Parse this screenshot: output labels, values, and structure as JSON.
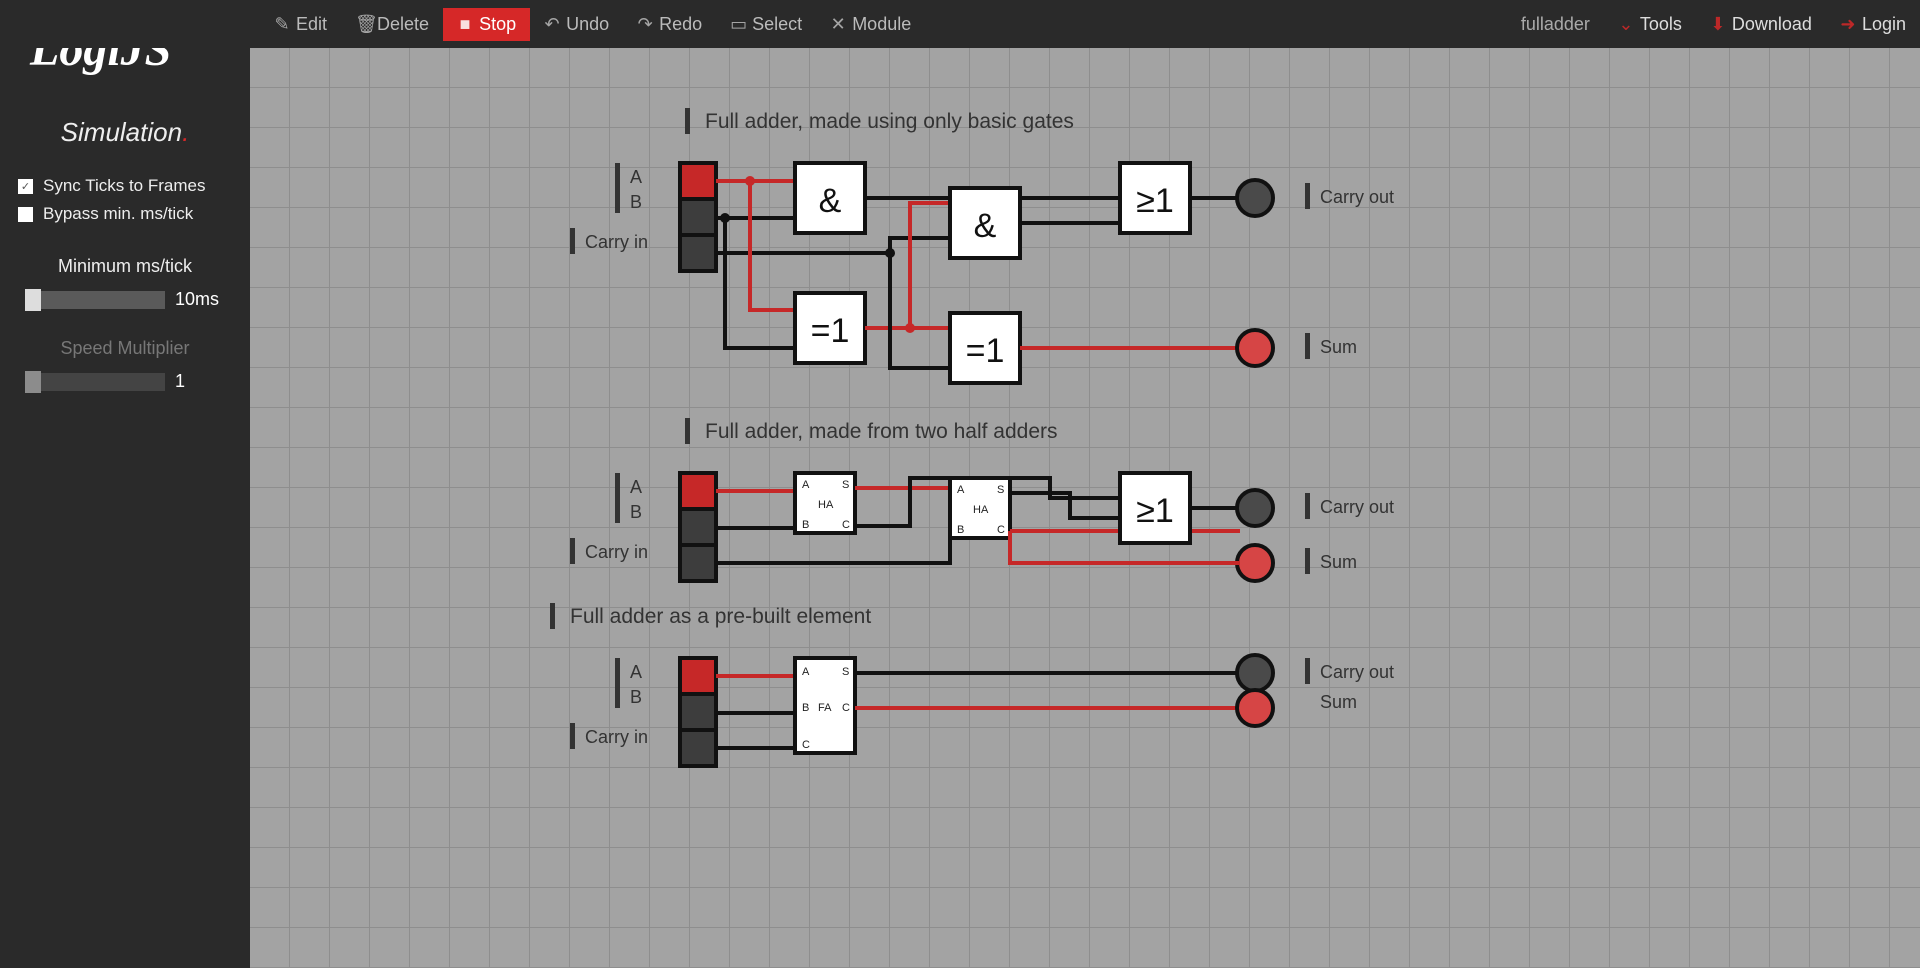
{
  "app": {
    "logo": "LogiJS",
    "sketch_name": "fulladder"
  },
  "toolbar": {
    "edit": "Edit",
    "delete": "Delete",
    "stop": "Stop",
    "undo": "Undo",
    "redo": "Redo",
    "select": "Select",
    "module": "Module",
    "tools": "Tools",
    "download": "Download",
    "login": "Login"
  },
  "sidebar": {
    "title": "Simulation",
    "sync_ticks": "Sync Ticks to Frames",
    "bypass": "Bypass min. ms/tick",
    "min_ms_label": "Minimum ms/tick",
    "min_ms_value": "10ms",
    "speed_label": "Speed Multiplier",
    "speed_value": "1"
  },
  "circuits": {
    "c1": {
      "title": "Full adder, made using only basic gates",
      "in_a": "A",
      "in_b": "B",
      "in_c": "Carry in",
      "out_c": "Carry out",
      "out_s": "Sum",
      "g_and": "&",
      "g_xor": "=1",
      "g_or": "≥1"
    },
    "c2": {
      "title": "Full adder, made from two half adders",
      "in_a": "A",
      "in_b": "B",
      "in_c": "Carry in",
      "out_c": "Carry out",
      "out_s": "Sum",
      "ha": "HA",
      "pa": "A",
      "pb": "B",
      "ps": "S",
      "pc": "C",
      "g_or": "≥1"
    },
    "c3": {
      "title": "Full adder as a pre-built element",
      "in_a": "A",
      "in_b": "B",
      "in_c": "Carry in",
      "out_c": "Carry out",
      "out_s": "Sum",
      "fa": "FA",
      "pa": "A",
      "pb": "B",
      "pc": "C",
      "ps": "S",
      "pco": "C"
    }
  }
}
